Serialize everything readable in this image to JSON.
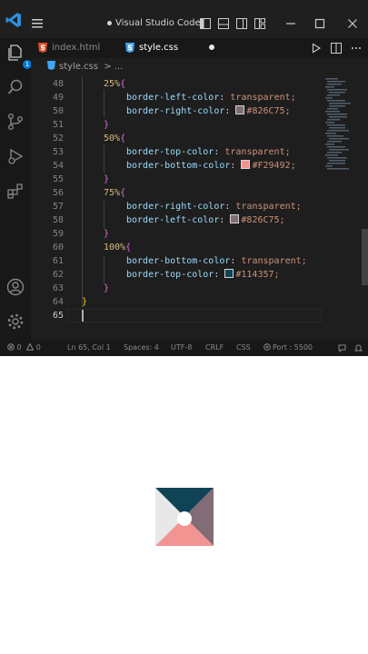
{
  "window": {
    "title": "Visual Studio Code",
    "modified": true
  },
  "tabs": [
    {
      "label": "index.html",
      "active": false
    },
    {
      "label": "style.css",
      "active": true
    }
  ],
  "breadcrumb": {
    "file": "style.css",
    "separator": ">",
    "more": "..."
  },
  "activity": {
    "explorer_badge": "1",
    "icons": [
      "files-icon",
      "search-icon",
      "source-control-icon",
      "run-debug-icon",
      "extensions-icon",
      "account-icon",
      "settings-gear-icon"
    ]
  },
  "editor": {
    "lines": [
      {
        "n": "48",
        "selector": "25%",
        "brace": "{"
      },
      {
        "n": "49",
        "prop": "border-left-color",
        "value": "transparent;"
      },
      {
        "n": "50",
        "prop": "border-right-color",
        "swatch": "#826C75",
        "value": "#826C75;"
      },
      {
        "n": "51",
        "close": "}"
      },
      {
        "n": "52",
        "selector": "50%",
        "brace": "{"
      },
      {
        "n": "53",
        "prop": "border-top-color",
        "value": "transparent;"
      },
      {
        "n": "54",
        "prop": "border-bottom-color",
        "swatch": "#F29492",
        "value": "#F29492;"
      },
      {
        "n": "55",
        "close": "}"
      },
      {
        "n": "56",
        "selector": "75%",
        "brace": "{"
      },
      {
        "n": "57",
        "prop": "border-right-color",
        "value": "transparent;"
      },
      {
        "n": "58",
        "prop": "border-left-color",
        "swatch": "#826C75",
        "value": "#826C75;"
      },
      {
        "n": "59",
        "close": "}"
      },
      {
        "n": "60",
        "selector": "100%",
        "brace": "{"
      },
      {
        "n": "61",
        "prop": "border-bottom-color",
        "value": "transparent;"
      },
      {
        "n": "62",
        "prop": "border-top-color",
        "swatch": "#114357",
        "value": "#114357;"
      },
      {
        "n": "63",
        "close": "}"
      },
      {
        "n": "64",
        "outer_close": "}"
      },
      {
        "n": "65"
      }
    ]
  },
  "status": {
    "errors": "0",
    "warnings": "0",
    "position": "Ln 65, Col 1",
    "spaces": "Spaces: 4",
    "encoding": "UTF-8",
    "eol": "CRLF",
    "language": "CSS",
    "port": "Port : 5500"
  },
  "preview": {
    "colors": {
      "top": "#114357",
      "right": "#826C75",
      "bottom": "#F29492",
      "left": "#e8e8e8",
      "center": "#ffffff"
    }
  }
}
